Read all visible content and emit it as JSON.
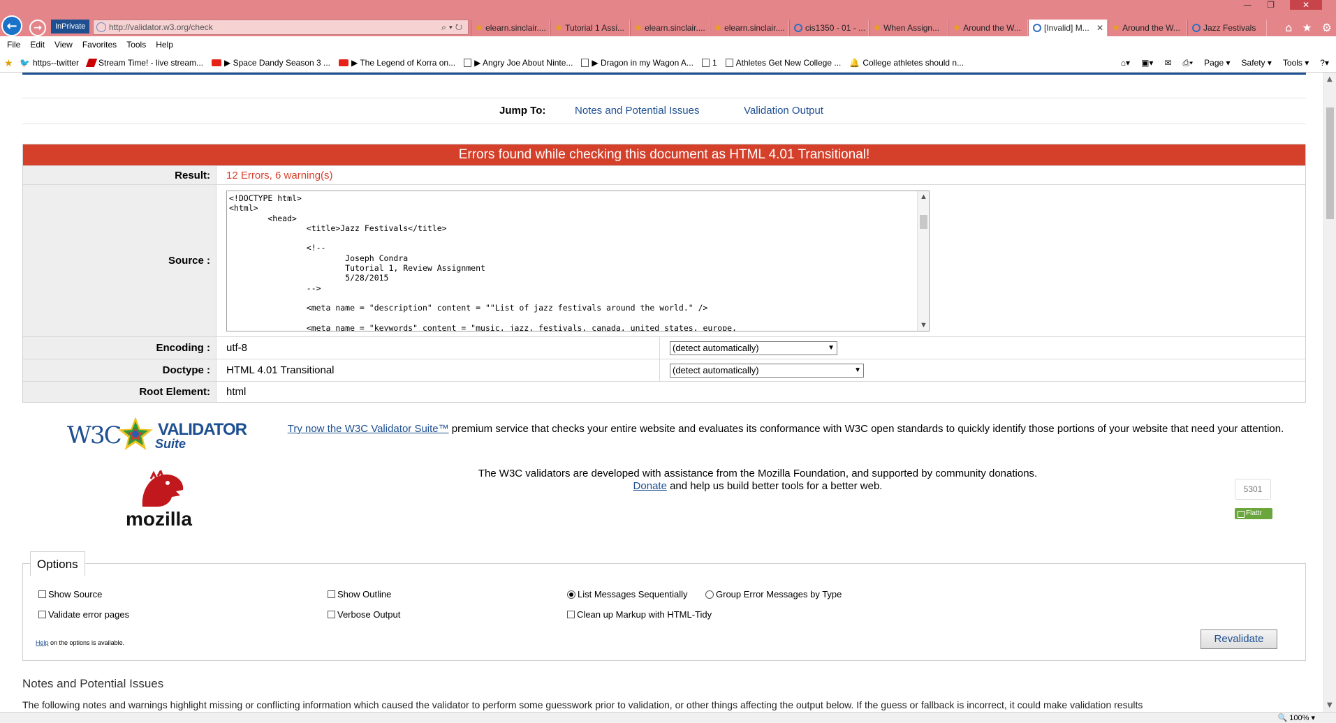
{
  "browser": {
    "inprivate_label": "InPrivate",
    "address_url": "http://validator.w3.org/check",
    "tabs": [
      {
        "label": "elearn.sinclair...."
      },
      {
        "label": "Tutorial 1 Assi..."
      },
      {
        "label": "elearn.sinclair...."
      },
      {
        "label": "elearn.sinclair...."
      },
      {
        "label": "cis1350 - 01 - ..."
      },
      {
        "label": "When Assign..."
      },
      {
        "label": "Around the W..."
      },
      {
        "label": "[Invalid] M..."
      },
      {
        "label": "Around the W..."
      },
      {
        "label": "Jazz Festivals"
      }
    ],
    "menu": [
      "File",
      "Edit",
      "View",
      "Favorites",
      "Tools",
      "Help"
    ],
    "favorites": [
      {
        "label": "https--twitter"
      },
      {
        "label": "Stream Time! - live stream..."
      },
      {
        "label": "▶ Space Dandy Season 3 ..."
      },
      {
        "label": "▶ The Legend of Korra on..."
      },
      {
        "label": "▶ Angry Joe About Ninte..."
      },
      {
        "label": "▶ Dragon in my Wagon A..."
      },
      {
        "label": "1"
      },
      {
        "label": "Athletes Get New College ..."
      },
      {
        "label": "College athletes should n..."
      }
    ],
    "command_bar": [
      "Page ▾",
      "Safety ▾",
      "Tools ▾"
    ],
    "zoom": "100%"
  },
  "jump": {
    "label": "Jump To:",
    "notes_link": "Notes and Potential Issues",
    "validation_link": "Validation Output"
  },
  "result": {
    "banner": "Errors found while checking this document as HTML 4.01 Transitional!",
    "result_label": "Result:",
    "result_value": "12 Errors, 6 warning(s)",
    "source_label": "Source :",
    "source_code": "<!DOCTYPE html>\n<html>\n        <head>\n                <title>Jazz Festivals</title>\n\n                <!--\n                        Joseph Condra\n                        Tutorial 1, Review Assignment\n                        5/28/2015\n                -->\n\n                <meta name = \"description\" content = \"\"List of jazz festivals around the world.\" />\n\n                <meta name = \"keywords\" content = \"music, jazz, festivals, canada, united states, europe,",
    "encoding_label": "Encoding :",
    "encoding_value": "utf-8",
    "encoding_select": "(detect automatically)",
    "doctype_label": "Doctype :",
    "doctype_value": "HTML 4.01 Transitional",
    "doctype_select": "(detect automatically)",
    "root_label": "Root Element:",
    "root_value": "html"
  },
  "promo": {
    "logo_w3c": "W3C",
    "logo_validator": "VALIDATOR",
    "logo_suite": "Suite",
    "link_text": "Try now the W3C Validator Suite™",
    "text": " premium service that checks your entire website and evaluates its conformance with W3C open standards to quickly identify those portions of your website that need your attention."
  },
  "mozilla": {
    "logo_word": "mozilla",
    "line1": "The W3C validators are developed with assistance from the Mozilla Foundation, and supported by community donations.",
    "donate_link": "Donate",
    "line2": " and help us build better tools for a better web.",
    "flattr_count": "5301",
    "flattr_label": "Flattr"
  },
  "options": {
    "title": "Options",
    "show_source": "Show Source",
    "show_outline": "Show Outline",
    "list_sequential": "List Messages Sequentially",
    "group_by_type": "Group Error Messages by Type",
    "validate_error_pages": "Validate error pages",
    "verbose_output": "Verbose Output",
    "clean_up": "Clean up Markup with HTML-Tidy",
    "help_link": "Help",
    "help_text": " on the options is available.",
    "revalidate": "Revalidate"
  },
  "notes": {
    "heading": "Notes and Potential Issues",
    "text": "The following notes and warnings highlight missing or conflicting information which caused the validator to perform some guesswork prior to validation, or other things affecting the output below. If the guess or fallback is incorrect, it could make validation results"
  }
}
